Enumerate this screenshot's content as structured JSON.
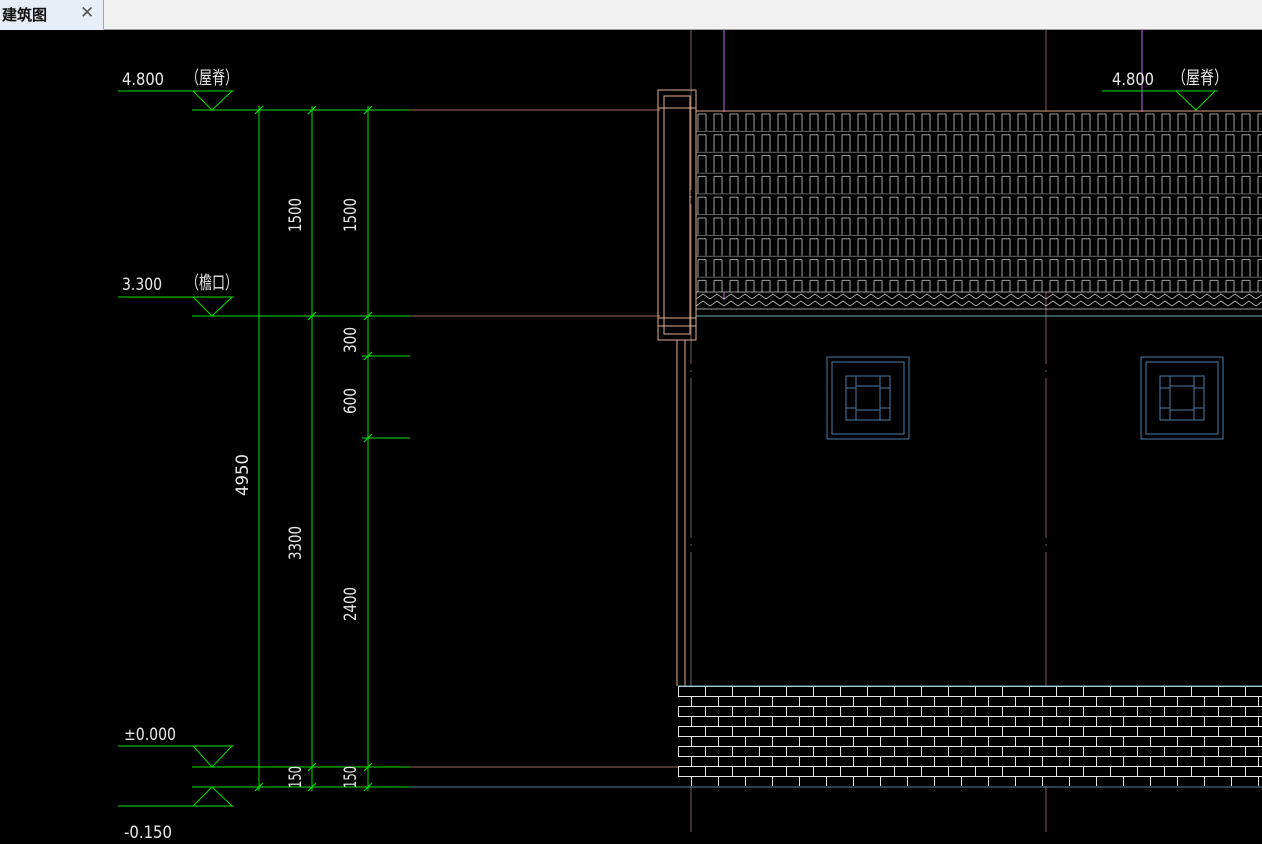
{
  "tab": {
    "title": "建筑图",
    "close_glyph": "✕"
  },
  "levels": {
    "ridge_left": {
      "value": "4.800",
      "label": "（屋脊）"
    },
    "eave": {
      "value": "3.300",
      "label": "（檐口）"
    },
    "ground": {
      "value": "±0.000"
    },
    "base": {
      "value": "-0.150"
    },
    "ridge_right": {
      "value": "4.800",
      "label": "（屋脊）"
    }
  },
  "dimensions": {
    "total": "4950",
    "roof_a": "1500",
    "roof_b": "1500",
    "wall_a": "3300",
    "base_a": "150",
    "base_b": "150",
    "seg_300": "300",
    "seg_600": "600",
    "seg_2400": "2400"
  },
  "colors": {
    "dim_line": "#00e000",
    "wall": "#e0b090",
    "tile": "#dddddd",
    "window": "#4a7ca8",
    "brick": "#e0e0e0",
    "axis": "#b080b0"
  }
}
